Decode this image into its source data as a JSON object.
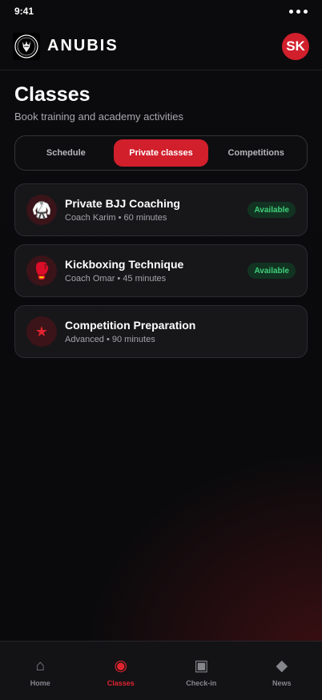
{
  "status_bar": {
    "time": "9:41"
  },
  "header": {
    "brand": "ANUBIS",
    "avatar_initials": "SK"
  },
  "page": {
    "title": "Classes",
    "subtitle": "Book training and academy activities"
  },
  "tabs": [
    {
      "label": "Schedule",
      "active": false
    },
    {
      "label": "Private classes",
      "active": true
    },
    {
      "label": "Competitions",
      "active": false
    }
  ],
  "classes": [
    {
      "icon": "gi-uniform-icon",
      "glyph": "🥋",
      "title": "Private BJJ Coaching",
      "meta": "Coach Karim • 60 minutes",
      "badge": "Available"
    },
    {
      "icon": "boxing-glove-icon",
      "glyph": "🥊",
      "title": "Kickboxing Technique",
      "meta": "Coach Omar • 45 minutes",
      "badge": "Available"
    },
    {
      "icon": "star-icon",
      "glyph": "★",
      "title": "Competition Preparation",
      "meta": "Advanced • 90 minutes",
      "badge": ""
    }
  ],
  "bottom_nav": [
    {
      "icon": "home-icon",
      "glyph": "⌂",
      "label": "Home",
      "active": false
    },
    {
      "icon": "classes-icon",
      "glyph": "◉",
      "label": "Classes",
      "active": true
    },
    {
      "icon": "check-in-icon",
      "glyph": "▣",
      "label": "Check-in",
      "active": false
    },
    {
      "icon": "news-icon",
      "glyph": "◆",
      "label": "News",
      "active": false
    }
  ],
  "colors": {
    "accent": "#d11f2c",
    "available_text": "#3fd17a",
    "available_bg": "#123322",
    "background": "#0b0b0d"
  }
}
